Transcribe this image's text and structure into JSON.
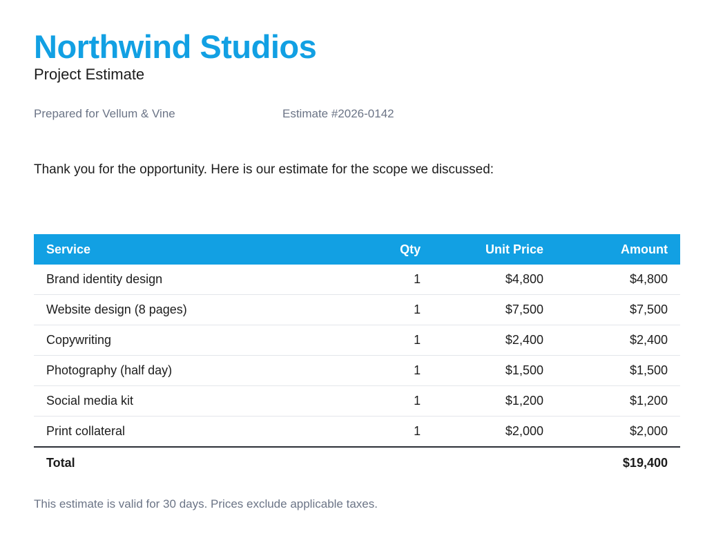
{
  "header": {
    "company": "Northwind Studios",
    "document_title": "Project Estimate"
  },
  "meta": {
    "prepared_for": "Prepared for Vellum & Vine",
    "estimate_number": "Estimate #2026-0142"
  },
  "intro": "Thank you for the opportunity. Here is our estimate for the scope we discussed:",
  "table": {
    "columns": {
      "service": "Service",
      "qty": "Qty",
      "unit_price": "Unit Price",
      "amount": "Amount"
    },
    "rows": [
      {
        "service": "Brand identity design",
        "qty": "1",
        "unit_price": "$4,800",
        "amount": "$4,800"
      },
      {
        "service": "Website design (8 pages)",
        "qty": "1",
        "unit_price": "$7,500",
        "amount": "$7,500"
      },
      {
        "service": "Copywriting",
        "qty": "1",
        "unit_price": "$2,400",
        "amount": "$2,400"
      },
      {
        "service": "Photography (half day)",
        "qty": "1",
        "unit_price": "$1,500",
        "amount": "$1,500"
      },
      {
        "service": "Social media kit",
        "qty": "1",
        "unit_price": "$1,200",
        "amount": "$1,200"
      },
      {
        "service": "Print collateral",
        "qty": "1",
        "unit_price": "$2,000",
        "amount": "$2,000"
      }
    ],
    "total_label": "Total",
    "total_amount": "$19,400"
  },
  "footnote": "This estimate is valid for 30 days. Prices exclude applicable taxes.",
  "colors": {
    "accent": "#12a0e3",
    "muted_text": "#6b7486",
    "body_text": "#1c1c1c"
  }
}
